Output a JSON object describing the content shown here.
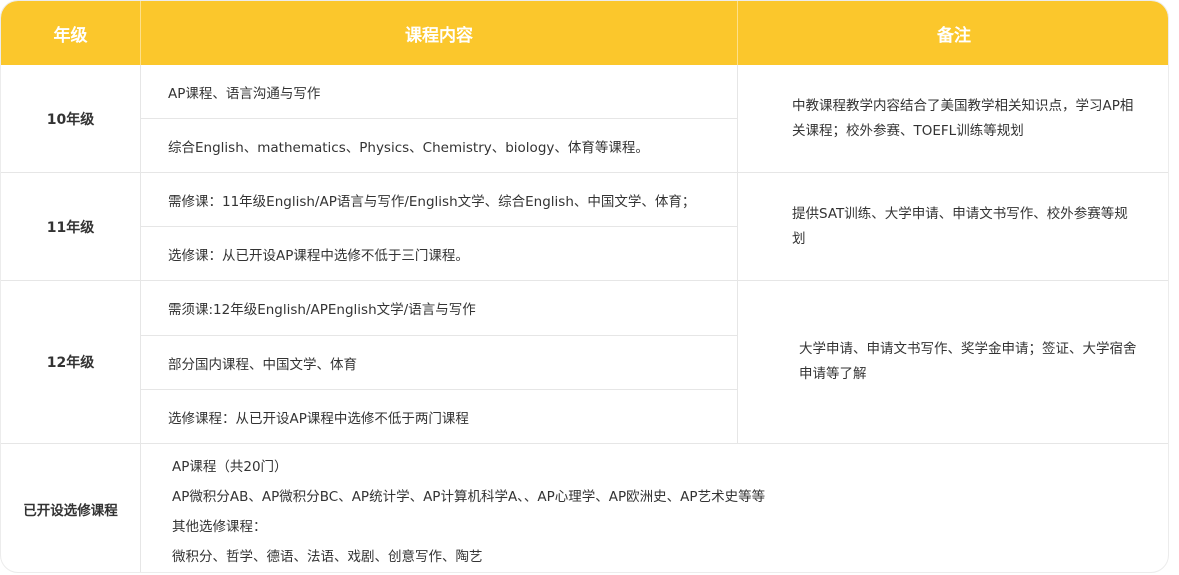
{
  "header": {
    "grade": "年级",
    "content": "课程内容",
    "note": "备注"
  },
  "rows": [
    {
      "grade": "10年级",
      "courses": [
        "AP课程、语言沟通与写作",
        "综合English、mathematics、Physics、Chemistry、biology、体育等课程。"
      ],
      "note": "中教课程教学内容结合了美国教学相关知识点，学习AP相关课程；校外参赛、TOEFL训练等规划"
    },
    {
      "grade": "11年级",
      "courses": [
        "需修课：11年级English/AP语言与写作/English文学、综合English、中国文学、体育；",
        "选修课：从已开设AP课程中选修不低于三门课程。"
      ],
      "note": "提供SAT训练、大学申请、申请文书写作、校外参赛等规划"
    },
    {
      "grade": "12年级",
      "courses": [
        "需须课:12年级English/APEnglish文学/语言与写作",
        "部分国内课程、中国文学、体育",
        "选修课程：从已开设AP课程中选修不低于两门课程"
      ],
      "note": "大学申请、申请文书写作、奖学金申请；签证、大学宿舍申请等了解"
    }
  ],
  "electives": {
    "grade": "已开设选修课程",
    "lines": [
      "AP课程（共20门）",
      "AP微积分AB、AP微积分BC、AP统计学、AP计算机科学A、、AP心理学、AP欧洲史、AP艺术史等等",
      "其他选修课程：",
      "微积分、哲学、德语、法语、戏剧、创意写作、陶艺"
    ]
  },
  "colors": {
    "header_bg": "#fbc72c",
    "header_text": "#ffffff",
    "border": "#e6e6e6"
  }
}
